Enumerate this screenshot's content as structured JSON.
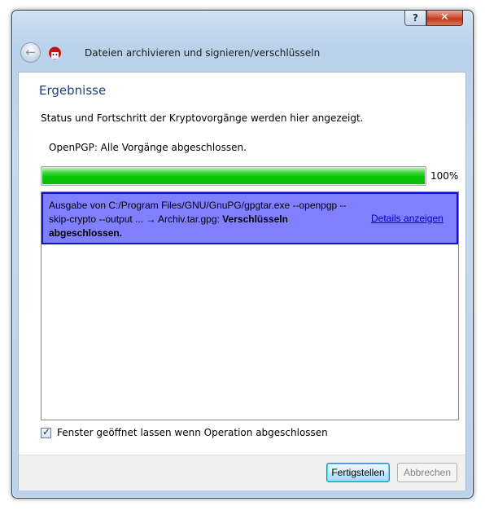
{
  "window": {
    "title": "Dateien archivieren und signieren/verschlüsseln",
    "help_button": "?",
    "close_button": "✕"
  },
  "header": {
    "back_icon": "back-arrow-icon",
    "app_icon": "kleopatra-app-icon"
  },
  "page": {
    "heading": "Ergebnisse",
    "description": "Status und Fortschritt der Kryptovorgänge werden hier angezeigt.",
    "operations_status": "OpenPGP: Alle Vorgänge abgeschlossen.",
    "progress": {
      "value": 1.0,
      "label": "100%"
    }
  },
  "results": [
    {
      "text": "Ausgabe von C:/Program Files/GNU/GnuPG/gpgtar.exe --openpgp --skip-crypto --output ... → Archiv.tar.gpg:",
      "status": "Verschlüsseln abgeschlossen.",
      "link": "Details anzeigen"
    }
  ],
  "options": {
    "keep_open_label": "Fenster geöffnet lassen wenn Operation abgeschlossen",
    "keep_open_checked": true
  },
  "footer": {
    "finish_label": "Fertigstellen",
    "cancel_label": "Abbrechen"
  },
  "colors": {
    "heading": "#1e3f8a",
    "progress_green": "#06c606",
    "result_background": "#8080ff",
    "result_border": "#1212cc",
    "link": "#0000cc"
  }
}
